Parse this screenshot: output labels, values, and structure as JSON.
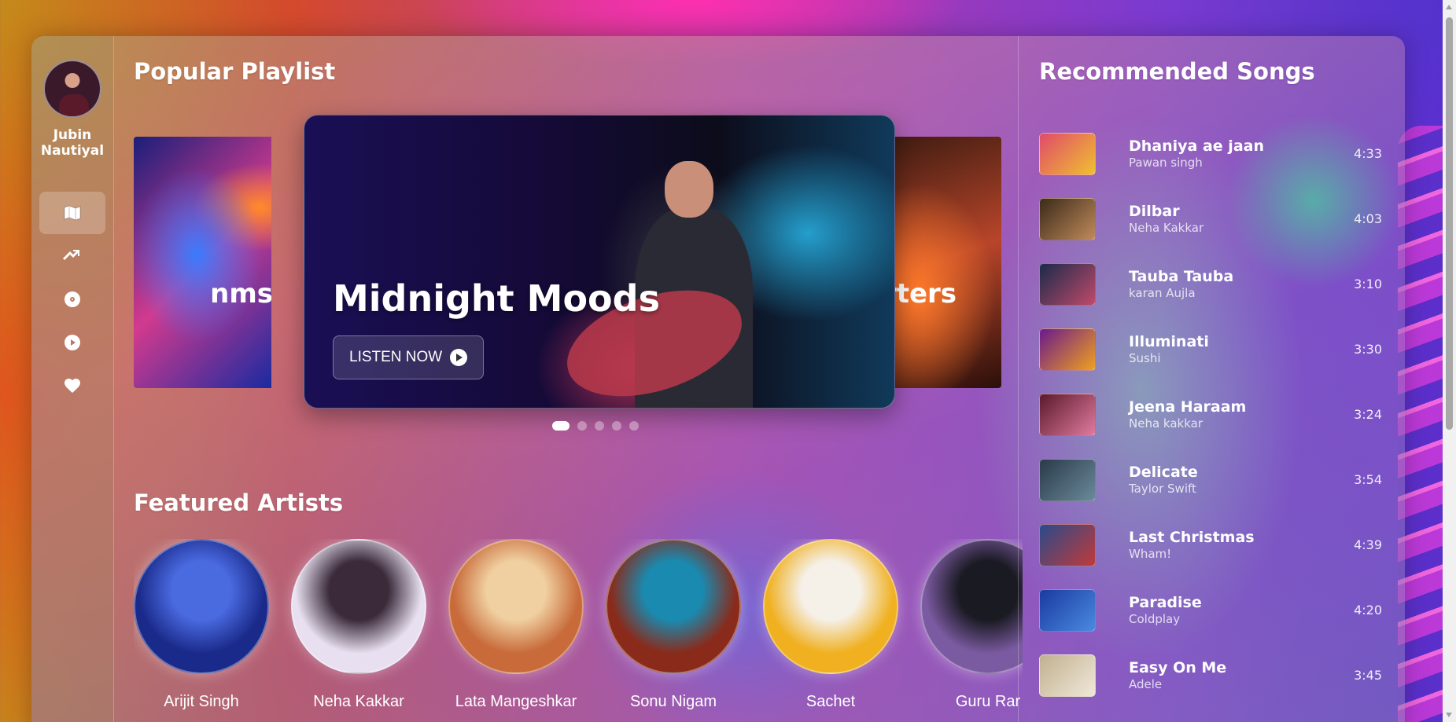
{
  "user": {
    "name_line1": "Jubin",
    "name_line2": "Nautiyal"
  },
  "nav": [
    {
      "icon": "map-icon",
      "active": true
    },
    {
      "icon": "trending-icon",
      "active": false
    },
    {
      "icon": "disc-icon",
      "active": false
    },
    {
      "icon": "play-circle-icon",
      "active": false
    },
    {
      "icon": "heart-icon",
      "active": false
    }
  ],
  "popular": {
    "title": "Popular Playlist",
    "left_card_label": "nms",
    "right_card_label": "arters",
    "hero_title": "Midnight Moods",
    "listen_label": "LISTEN NOW",
    "active_slide": 1,
    "slide_count": 5
  },
  "featured": {
    "title": "Featured Artists",
    "artists": [
      {
        "name": "Arijit Singh",
        "colors": [
          "#1a2a8a",
          "#4a6ae0"
        ]
      },
      {
        "name": "Neha Kakkar",
        "colors": [
          "#e8e0f0",
          "#3a2a3a"
        ]
      },
      {
        "name": "Lata Mangeshkar",
        "colors": [
          "#c86a3a",
          "#f0d0a0"
        ]
      },
      {
        "name": "Sonu Nigam",
        "colors": [
          "#8a2a1a",
          "#1a8ab0"
        ]
      },
      {
        "name": "Sachet",
        "colors": [
          "#f0b020",
          "#f5f0e8"
        ]
      },
      {
        "name": "Guru Rar",
        "colors": [
          "#7a5aa0",
          "#1a1a22"
        ]
      }
    ]
  },
  "recommended": {
    "title": "Recommended Songs",
    "songs": [
      {
        "title": "Dhaniya ae jaan",
        "artist": "Pawan singh",
        "duration": "4:33",
        "thumb": [
          "#e04a6a",
          "#f0c030"
        ]
      },
      {
        "title": "Dilbar",
        "artist": "Neha Kakkar",
        "duration": "4:03",
        "thumb": [
          "#3a2a1a",
          "#c08a5a"
        ]
      },
      {
        "title": "Tauba Tauba",
        "artist": "karan Aujla",
        "duration": "3:10",
        "thumb": [
          "#1a2a4a",
          "#c04a6a"
        ]
      },
      {
        "title": "Illuminati",
        "artist": "Sushi",
        "duration": "3:30",
        "thumb": [
          "#6a1a8a",
          "#f0a020"
        ]
      },
      {
        "title": "Jeena Haraam",
        "artist": "Neha kakkar",
        "duration": "3:24",
        "thumb": [
          "#5a1a2a",
          "#e07aa0"
        ]
      },
      {
        "title": "Delicate",
        "artist": "Taylor Swift",
        "duration": "3:54",
        "thumb": [
          "#2a3a4a",
          "#6a8a9a"
        ]
      },
      {
        "title": "Last Christmas",
        "artist": "Wham!",
        "duration": "4:39",
        "thumb": [
          "#2a4a8a",
          "#c03a3a"
        ]
      },
      {
        "title": "Paradise",
        "artist": "Coldplay",
        "duration": "4:20",
        "thumb": [
          "#1a3aa0",
          "#4a8ae0"
        ]
      },
      {
        "title": "Easy On Me",
        "artist": "Adele",
        "duration": "3:45",
        "thumb": [
          "#c0b090",
          "#f0e8d8"
        ]
      }
    ]
  }
}
